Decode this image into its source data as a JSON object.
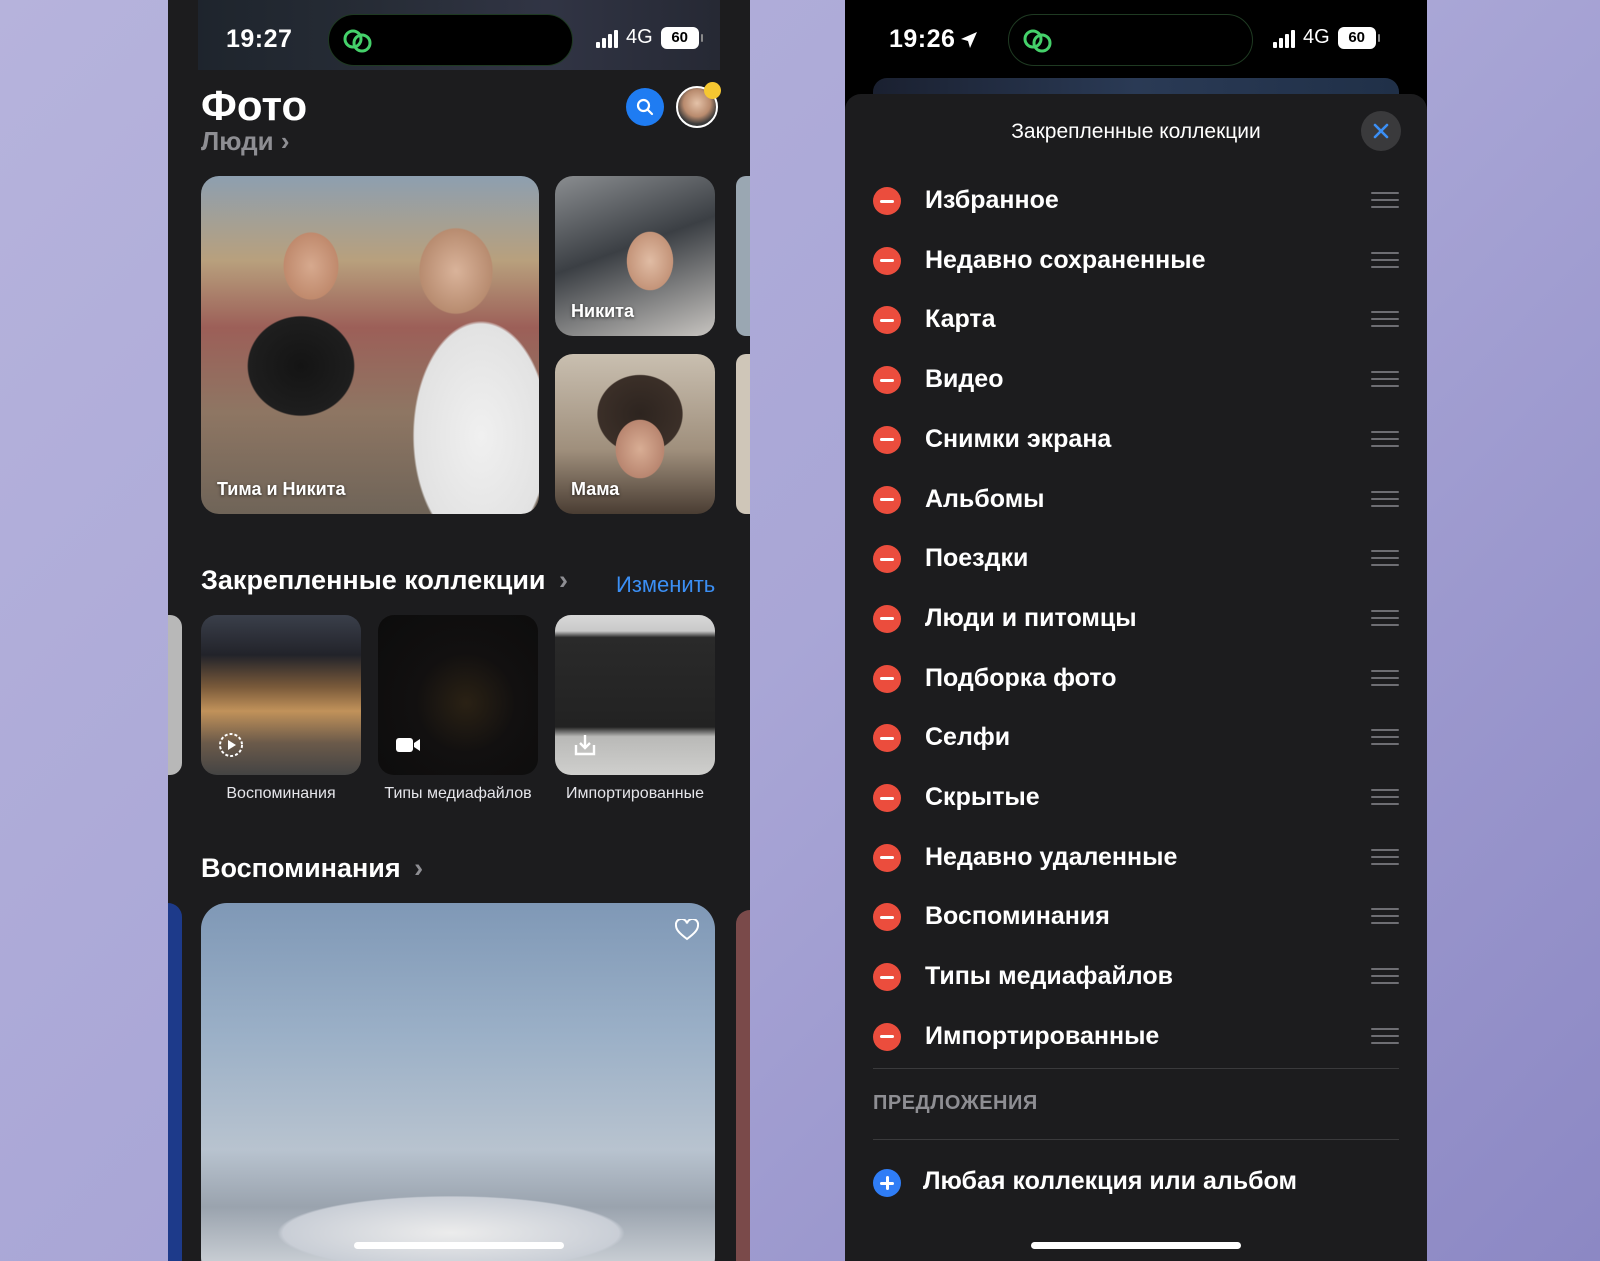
{
  "left": {
    "status": {
      "time": "19:27",
      "network": "4G",
      "battery": "60"
    },
    "header": {
      "title": "Фото",
      "subtitle": "Люди",
      "chevron": "›"
    },
    "people": [
      {
        "label": "Тима и Никита"
      },
      {
        "label": "Никита"
      },
      {
        "label": "Мама"
      }
    ],
    "pinned": {
      "title": "Закрепленные коллекции",
      "chevron": "›",
      "edit_label": "Изменить",
      "items": [
        {
          "label": "Воспоминания",
          "icon": "memories-play-icon"
        },
        {
          "label": "Типы медиафайлов",
          "icon": "video-camera-icon"
        },
        {
          "label": "Импортированные",
          "icon": "import-icon"
        }
      ]
    },
    "memories": {
      "title": "Воспоминания",
      "chevron": "›",
      "icon": "heart-icon"
    },
    "colors": {
      "accent": "#1f7cf2",
      "link": "#3b8ff5",
      "badge": "#f6c731"
    }
  },
  "right": {
    "status": {
      "time": "19:26",
      "network": "4G",
      "battery": "60"
    },
    "sheet": {
      "title": "Закрепленные коллекции",
      "items": [
        "Избранное",
        "Недавно сохраненные",
        "Карта",
        "Видео",
        "Снимки экрана",
        "Альбомы",
        "Поездки",
        "Люди и питомцы",
        "Подборка фото",
        "Селфи",
        "Скрытые",
        "Недавно удаленные",
        "Воспоминания",
        "Типы медиафайлов",
        "Импортированные"
      ],
      "suggestions_header": "ПРЕДЛОЖЕНИЯ",
      "add_label": "Любая коллекция или альбом"
    },
    "colors": {
      "remove": "#eb4d3d",
      "add": "#2f7df6"
    }
  }
}
